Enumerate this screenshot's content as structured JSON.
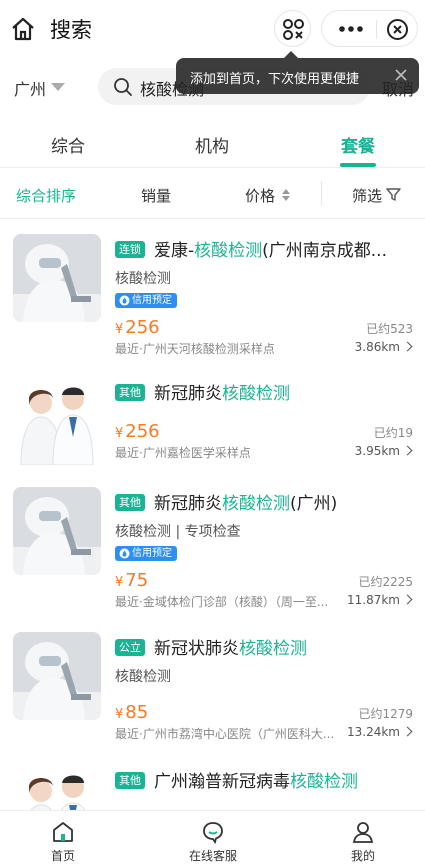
{
  "header": {
    "title": "搜索"
  },
  "search": {
    "city": "广州",
    "query": "核酸检测",
    "cancel_label": "取消"
  },
  "tooltip": {
    "text": "添加到首页，下次使用更便捷"
  },
  "tabs": [
    {
      "label": "综合",
      "active": false
    },
    {
      "label": "机构",
      "active": false
    },
    {
      "label": "套餐",
      "active": true
    }
  ],
  "filters": {
    "sort": "综合排序",
    "sales": "销量",
    "price": "价格",
    "filter": "筛选"
  },
  "results": [
    {
      "tag": "连锁",
      "name_pre": "爱康-",
      "name_hl": "核酸检测",
      "name_post": "(广州南京成都...",
      "sub": "核酸检测",
      "credit": "信用预定",
      "currency": "¥",
      "price": "256",
      "sold": "已约523",
      "addr": "最近·广州天河核酸检测采样点",
      "dist": "3.86km"
    },
    {
      "tag": "其他",
      "name_pre": "新冠肺炎",
      "name_hl": "核酸检测",
      "name_post": "",
      "sub": "",
      "credit": "",
      "currency": "¥",
      "price": "256",
      "sold": "已约19",
      "addr": "最近·广州嘉检医学采样点",
      "dist": "3.95km"
    },
    {
      "tag": "其他",
      "name_pre": "新冠肺炎",
      "name_hl": "核酸检测",
      "name_post": "(广州)",
      "sub": "核酸检测 | 专项检查",
      "credit": "信用预定",
      "currency": "¥",
      "price": "75",
      "sold": "已约2225",
      "addr": "最近·金域体检门诊部（核酸）（周一至...",
      "dist": "11.87km"
    },
    {
      "tag": "公立",
      "name_pre": "新冠状肺炎",
      "name_hl": "核酸检测",
      "name_post": "",
      "sub": "核酸检测",
      "credit": "",
      "currency": "¥",
      "price": "85",
      "sold": "已约1279",
      "addr": "最近·广州市荔湾中心医院（广州医科大...",
      "dist": "13.24km"
    },
    {
      "tag": "其他",
      "name_pre": "广州瀚普新冠病毒",
      "name_hl": "核酸检测",
      "name_post": "",
      "sub": "",
      "credit": "",
      "currency": "",
      "price": "",
      "sold": "",
      "addr": "",
      "dist": ""
    }
  ],
  "bottom_nav": [
    {
      "label": "首页",
      "icon": "home-icon"
    },
    {
      "label": "在线客服",
      "icon": "chat-icon"
    },
    {
      "label": "我的",
      "icon": "user-icon"
    }
  ],
  "colors": {
    "accent": "#1ab394",
    "price": "#f57a22",
    "credit": "#2e8ff0"
  }
}
